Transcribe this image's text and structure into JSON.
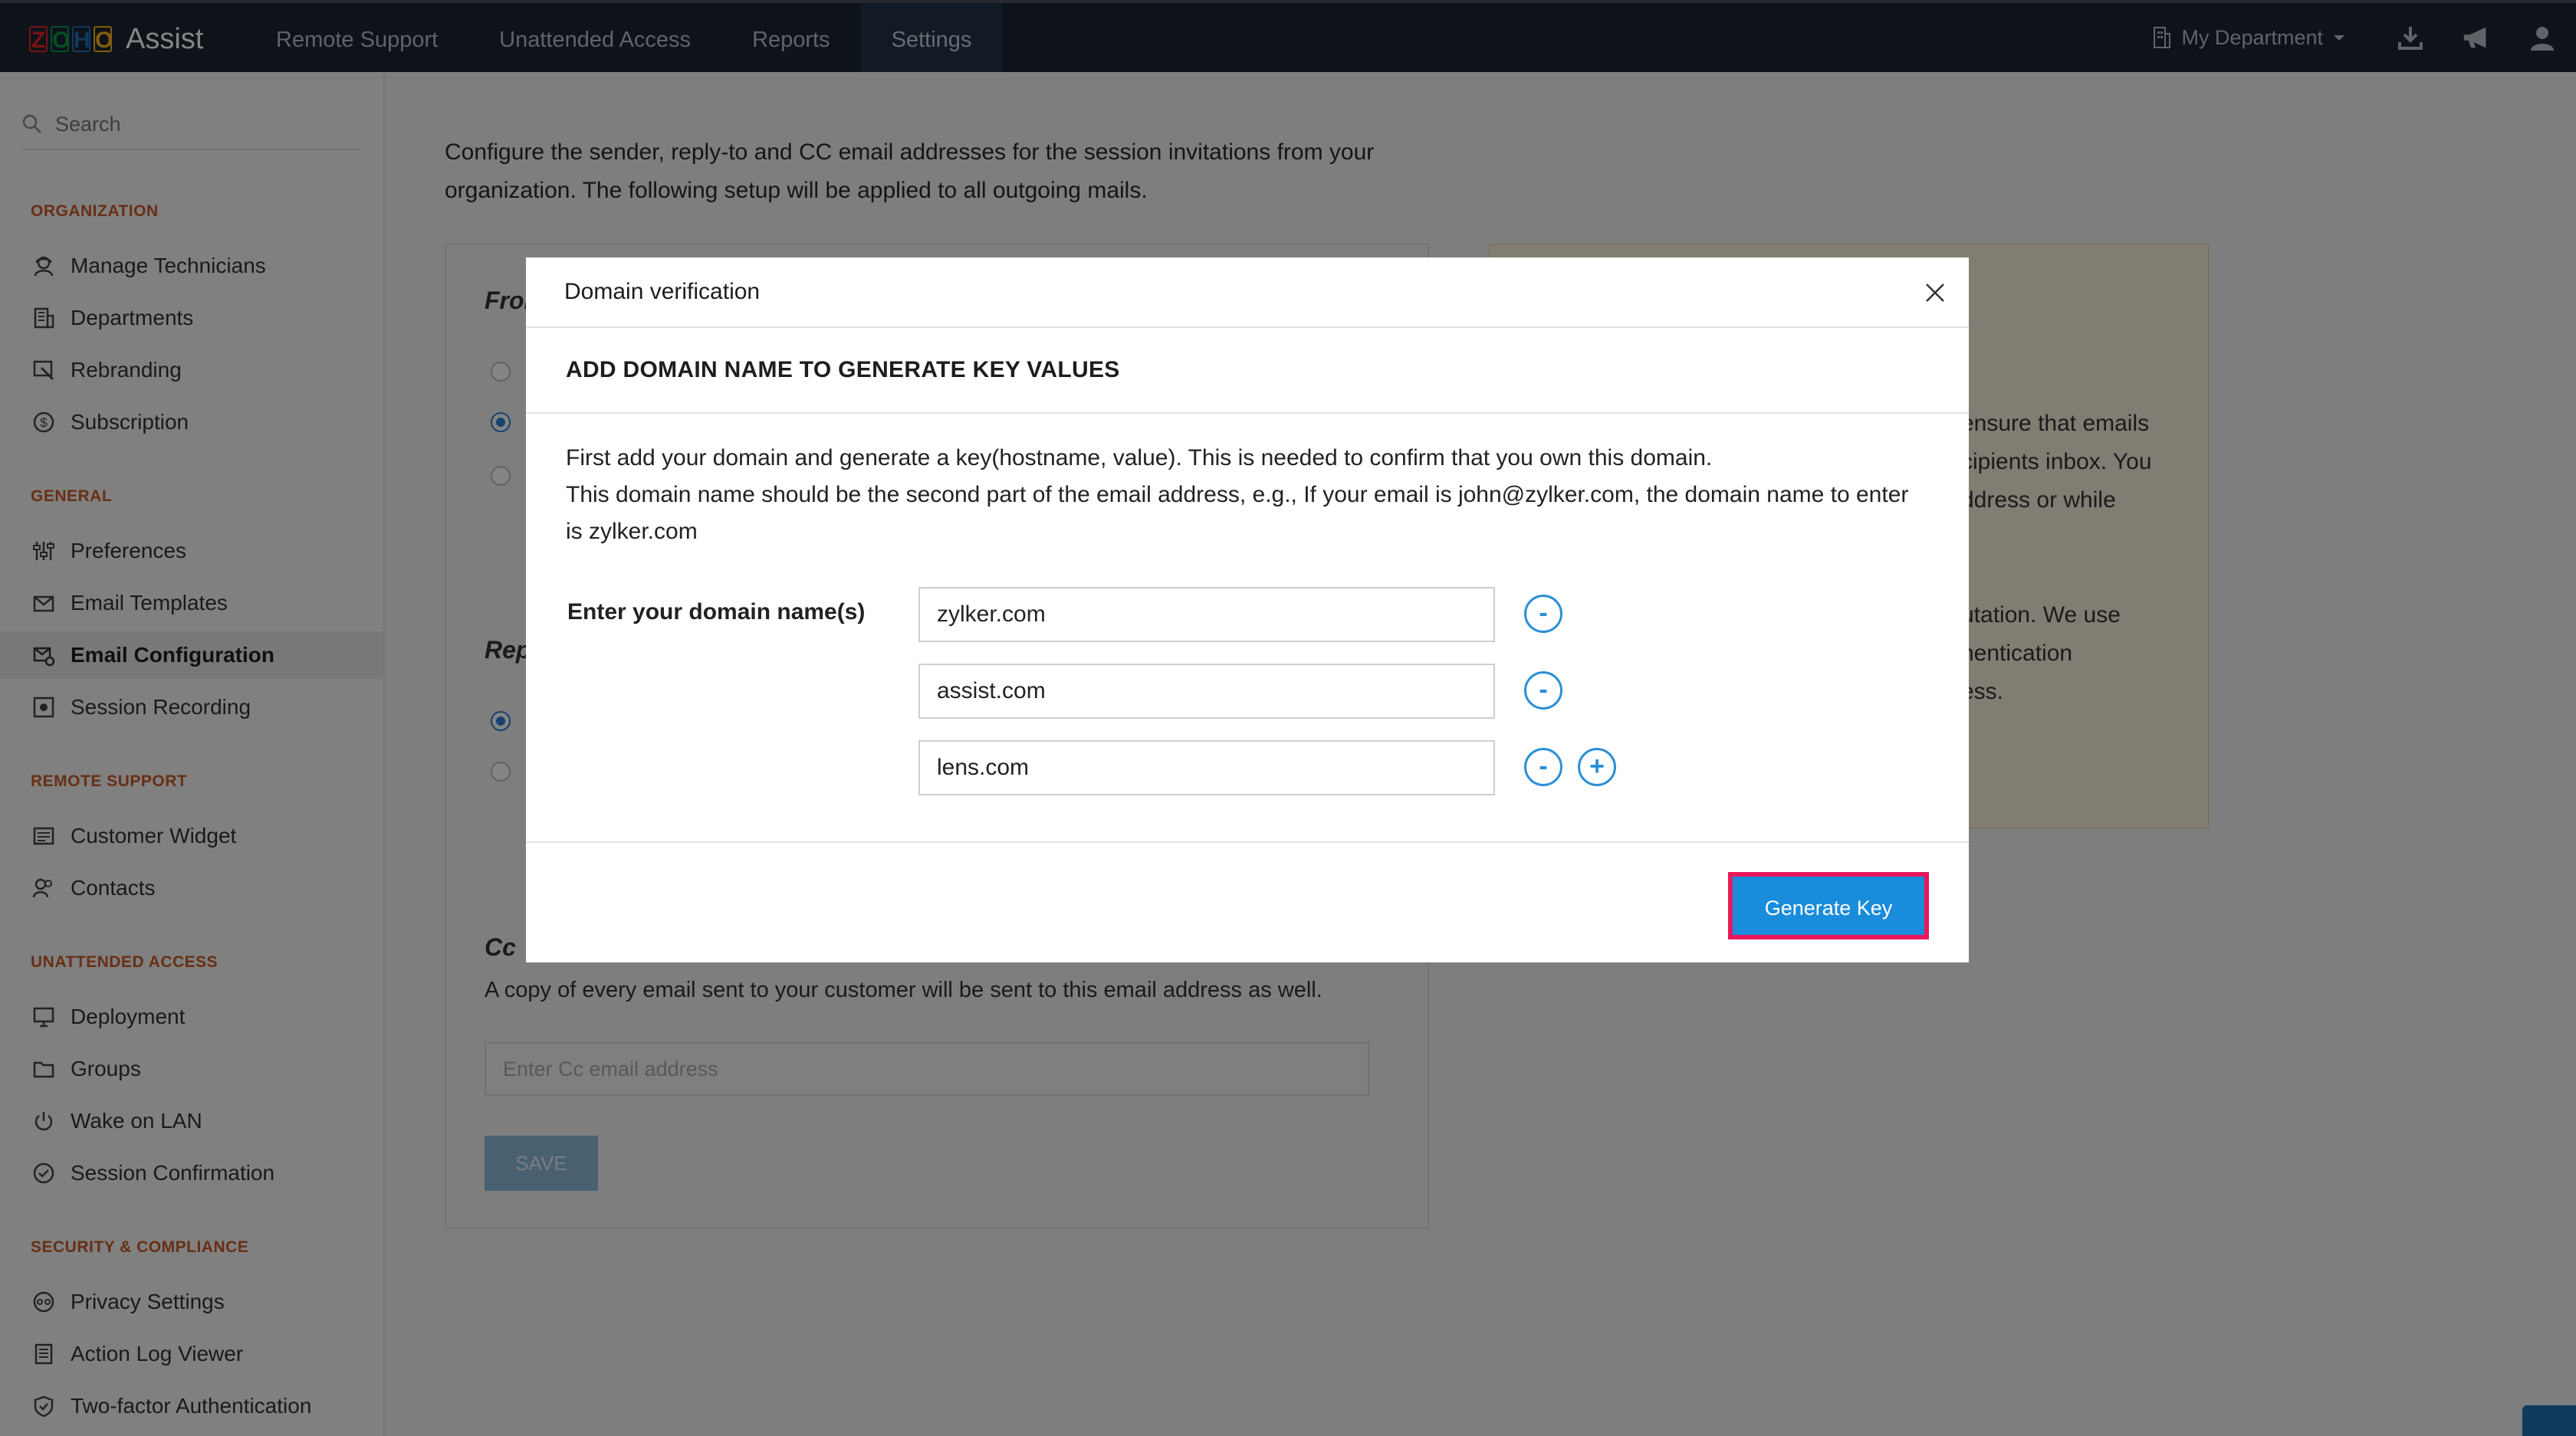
{
  "app": {
    "logo_letters": [
      "Z",
      "O",
      "H",
      "O"
    ],
    "logo_colors": [
      "#e42527",
      "#089949",
      "#226db4",
      "#f9b21d"
    ],
    "name": "Assist"
  },
  "nav": {
    "items": [
      "Remote Support",
      "Unattended Access",
      "Reports",
      "Settings"
    ],
    "active": "Settings",
    "department": "My Department"
  },
  "sidebar": {
    "search_placeholder": "Search",
    "sections": [
      {
        "title": "ORGANIZATION",
        "items": [
          "Manage Technicians",
          "Departments",
          "Rebranding",
          "Subscription"
        ]
      },
      {
        "title": "GENERAL",
        "items": [
          "Preferences",
          "Email Templates",
          "Email Configuration",
          "Session Recording"
        ]
      },
      {
        "title": "REMOTE SUPPORT",
        "items": [
          "Customer Widget",
          "Contacts"
        ]
      },
      {
        "title": "UNATTENDED ACCESS",
        "items": [
          "Deployment",
          "Groups",
          "Wake on LAN",
          "Session Confirmation"
        ]
      },
      {
        "title": "SECURITY & COMPLIANCE",
        "items": [
          "Privacy Settings",
          "Action Log Viewer",
          "Two-factor Authentication"
        ]
      }
    ],
    "active_item": "Email Configuration"
  },
  "main": {
    "description": "Configure the sender, reply-to and CC email addresses for the session invitations from your organization. The following setup will be applied to all outgoing mails.",
    "from_label": "Fron",
    "reply_label": "Rep",
    "cc_label": "Cc",
    "cc_description": "A copy of every email sent to your customer will be sent to this email address as well.",
    "cc_placeholder": "Enter Cc email address",
    "save_label": "SAVE",
    "right_text_lines": [
      "ensure that emails",
      "cipients inbox. You",
      "ddress or while",
      "utation. We use",
      "nentication",
      "ess."
    ]
  },
  "modal": {
    "title": "Domain verification",
    "subtitle": "ADD DOMAIN NAME TO GENERATE KEY VALUES",
    "desc_line1": "First add your domain and generate a key(hostname, value). This is needed to confirm that you own this domain.",
    "desc_line2": "This domain name should be the second part of the email address, e.g., If your email is john@zylker.com, the domain name to enter is zylker.com",
    "form_label": "Enter your domain name(s)",
    "domains": [
      "zylker.com",
      "assist.com",
      "lens.com"
    ],
    "remove_symbol": "-",
    "add_symbol": "+",
    "generate_label": "Generate Key"
  }
}
